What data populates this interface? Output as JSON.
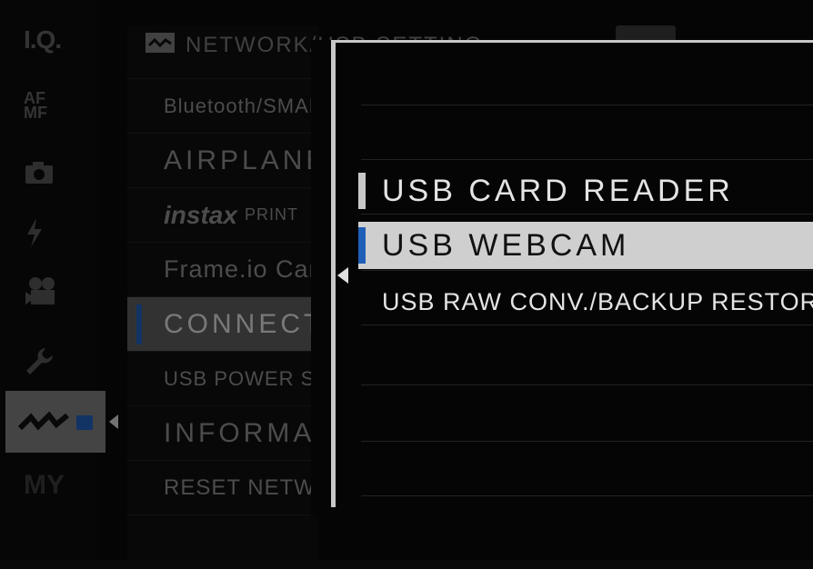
{
  "tabs": [
    {
      "icon": "image-quality-icon",
      "label": "I.Q."
    },
    {
      "icon": "af-mf-icon",
      "label": "AF MF"
    },
    {
      "icon": "camera-icon",
      "label": ""
    },
    {
      "icon": "flash-icon",
      "label": ""
    },
    {
      "icon": "movie-icon",
      "label": ""
    },
    {
      "icon": "wrench-icon",
      "label": ""
    },
    {
      "icon": "network-icon",
      "label": ""
    },
    {
      "icon": "my-menu-icon",
      "label": "MY"
    }
  ],
  "header": {
    "title": "NETWORK/USB SETTING"
  },
  "list": {
    "items": [
      {
        "label": "Bluetooth/SMARTPHONE SETTING"
      },
      {
        "label": "AIRPLANE MODE"
      },
      {
        "label": "PRINTER CONNECTION SETTING",
        "brand": "instax",
        "small": "PRINT"
      },
      {
        "label": "Frame.io Camera to Cloud"
      },
      {
        "label": "CONNECTION MODE"
      },
      {
        "label": "USB POWER SUPPLY/COMM SETTING"
      },
      {
        "label": "INFORMATION"
      },
      {
        "label": "RESET NETWORK/USB SETTING"
      }
    ]
  },
  "submenu": {
    "options": [
      {
        "label": "USB CARD READER",
        "selected": false
      },
      {
        "label": "USB WEBCAM",
        "selected": true
      },
      {
        "label": "USB RAW CONV./BACKUP RESTORE",
        "selected": false
      }
    ]
  },
  "colors": {
    "accent": "#1f5fb7",
    "highlight": "#cfcfcf"
  }
}
